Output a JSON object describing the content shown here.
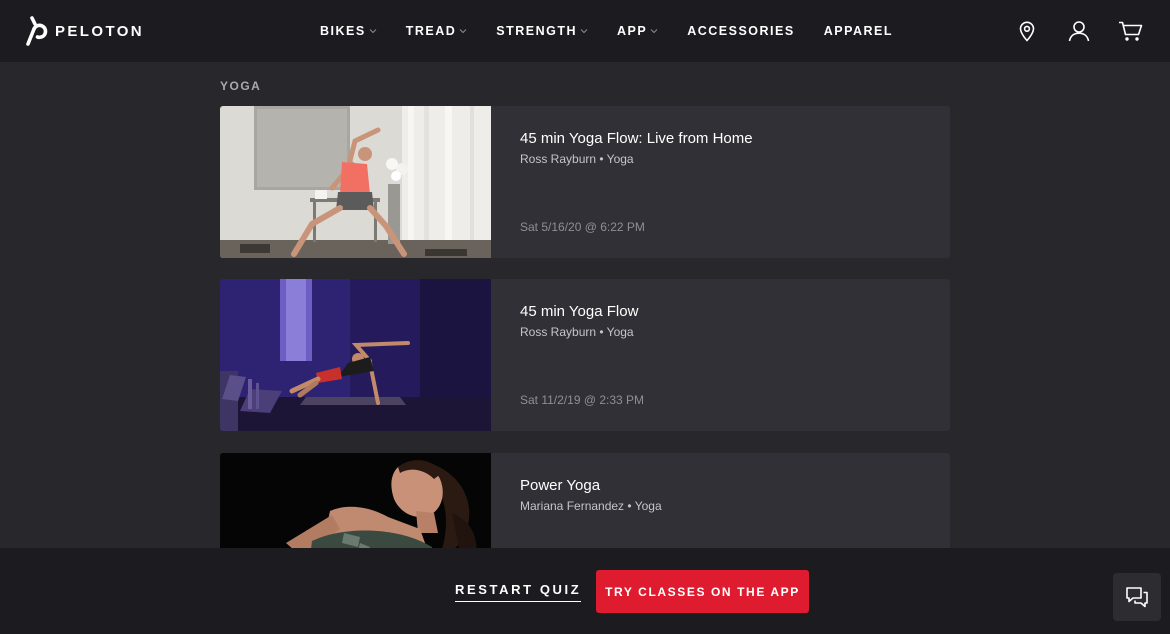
{
  "brand": {
    "name": "PELOTON",
    "logo_icon": "peloton-p-icon"
  },
  "nav": {
    "links": [
      {
        "label": "BIKES",
        "has_dropdown": true
      },
      {
        "label": "TREAD",
        "has_dropdown": true
      },
      {
        "label": "STRENGTH",
        "has_dropdown": true
      },
      {
        "label": "APP",
        "has_dropdown": true
      },
      {
        "label": "ACCESSORIES",
        "has_dropdown": false
      },
      {
        "label": "APPAREL",
        "has_dropdown": false
      }
    ],
    "icons": [
      "location-pin-icon",
      "user-icon",
      "cart-icon"
    ]
  },
  "section": {
    "label": "YOGA"
  },
  "classes": [
    {
      "title": "45 min Yoga Flow: Live from Home",
      "meta": "Ross Rayburn • Yoga",
      "date": "Sat 5/16/20 @ 6:22 PM"
    },
    {
      "title": "45 min Yoga Flow",
      "meta": "Ross Rayburn • Yoga",
      "date": "Sat 11/2/19 @ 2:33 PM"
    },
    {
      "title": "Power Yoga",
      "meta": "Mariana Fernandez • Yoga",
      "date": ""
    }
  ],
  "footer": {
    "restart_label": "RESTART QUIZ",
    "try_label": "TRY CLASSES ON THE APP",
    "chat_icon": "chat-icon"
  },
  "colors": {
    "background": "#27272c",
    "nav_bg": "#1c1c20",
    "card_bg": "#303036",
    "accent_red": "#df1c2f"
  }
}
